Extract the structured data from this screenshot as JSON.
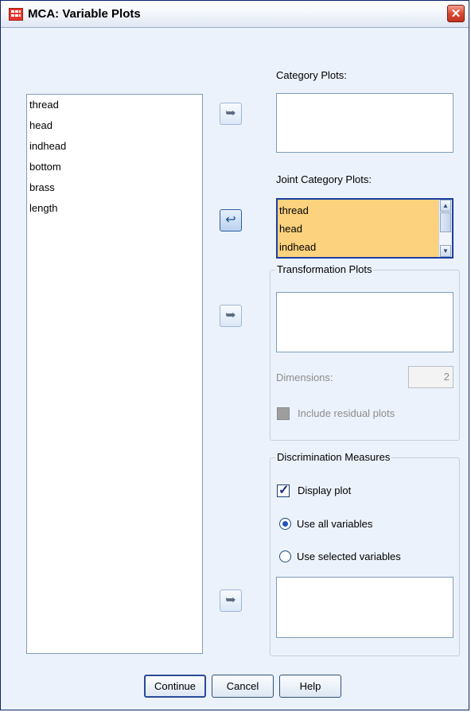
{
  "window": {
    "title": "MCA: Variable Plots",
    "close_glyph": "✕",
    "app_icon": "grid-app-icon"
  },
  "source_list": {
    "items": [
      "thread",
      "head",
      "indhead",
      "bottom",
      "brass",
      "length"
    ]
  },
  "category_plots": {
    "label": "Category Plots:",
    "items": []
  },
  "joint_category_plots": {
    "label": "Joint Category Plots:",
    "items": [
      "thread",
      "head",
      "indhead"
    ],
    "highlight_color": "#fcd27e"
  },
  "transformation_plots": {
    "legend": "Transformation Plots",
    "items": [],
    "dimensions_label": "Dimensions:",
    "dimensions_value": "2",
    "include_residual_label": "Include residual plots",
    "include_residual_checked": false,
    "enabled": false
  },
  "discrimination_measures": {
    "legend": "Discrimination Measures",
    "display_plot_label": "Display plot",
    "display_plot_checked": true,
    "use_all_label": "Use all variables",
    "use_selected_label": "Use selected variables",
    "selected_option": "use_all",
    "items": []
  },
  "arrows": {
    "move_right": "➥",
    "move_left": "↩"
  },
  "buttons": {
    "continue": "Continue",
    "cancel": "Cancel",
    "help": "Help"
  }
}
